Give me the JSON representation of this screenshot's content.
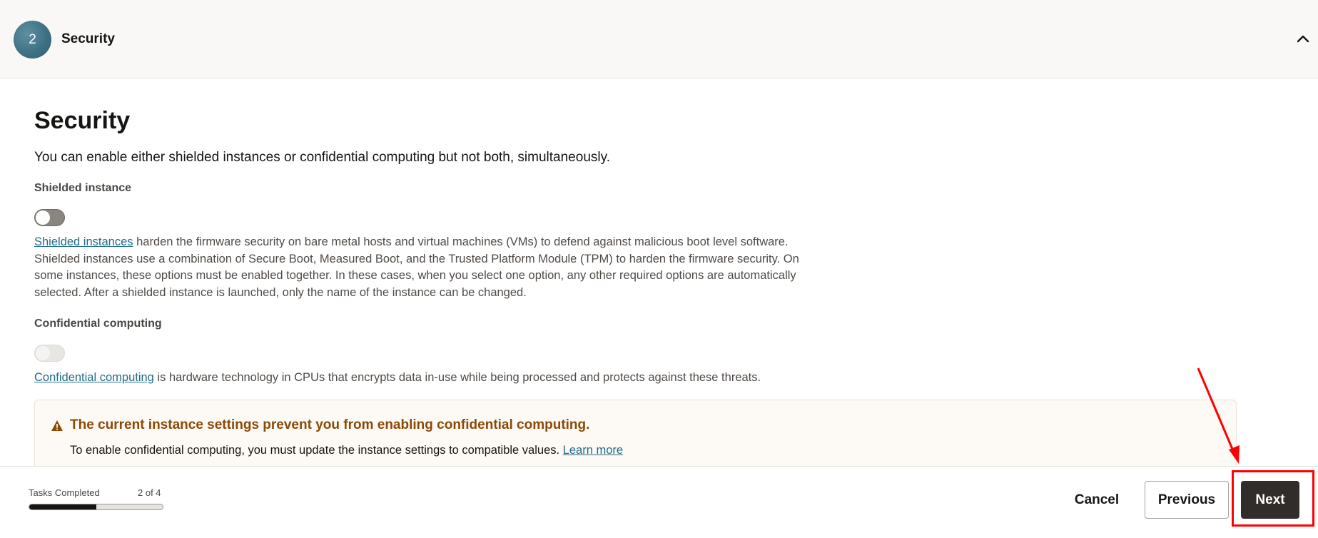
{
  "step": {
    "number": "2",
    "title": "Security"
  },
  "page": {
    "title": "Security",
    "intro": "You can enable either shielded instances or confidential computing but not both, simultaneously."
  },
  "shielded": {
    "label": "Shielded instance",
    "toggle_state": "off",
    "link_text": "Shielded instances",
    "description": " harden the firmware security on bare metal hosts and virtual machines (VMs) to defend against malicious boot level software. Shielded instances use a combination of Secure Boot, Measured Boot, and the Trusted Platform Module (TPM) to harden the firmware security. On some instances, these options must be enabled together. In these cases, when you select one option, any other required options are automatically selected. After a shielded instance is launched, only the name of the instance can be changed."
  },
  "confidential": {
    "label": "Confidential computing",
    "toggle_state": "disabled",
    "link_text": "Confidential computing",
    "description": " is hardware technology in CPUs that encrypts data in-use while being processed and protects against these threats."
  },
  "warning": {
    "title": "The current instance settings prevent you from enabling confidential computing.",
    "body": "To enable confidential computing, you must update the instance settings to compatible values. ",
    "link_text": "Learn more",
    "icon": "warning-icon",
    "color": "#8a4a05"
  },
  "footer": {
    "tasks_label": "Tasks Completed",
    "tasks_count": "2 of 4",
    "progress_fraction": 0.5,
    "cancel_label": "Cancel",
    "previous_label": "Previous",
    "next_label": "Next"
  },
  "colors": {
    "accent_link": "#226d89",
    "primary_button": "#312d2a",
    "annotation": "#ff0000",
    "step_badge": "#3f7185"
  }
}
